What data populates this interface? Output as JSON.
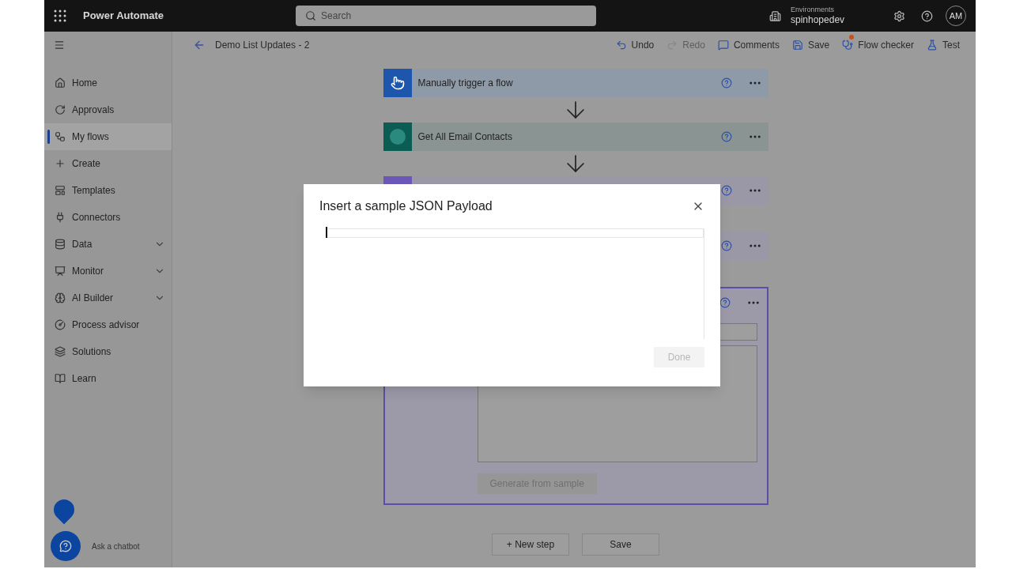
{
  "app": {
    "name": "Power Automate"
  },
  "search": {
    "placeholder": "Search"
  },
  "environment": {
    "label": "Environments",
    "name": "spinhopedev"
  },
  "user": {
    "initials": "AM"
  },
  "flow_title": "Demo List Updates - 2",
  "toolbar": [
    {
      "label": "Undo",
      "disabled": false,
      "alert": false
    },
    {
      "label": "Redo",
      "disabled": true,
      "alert": false
    },
    {
      "label": "Comments",
      "disabled": false,
      "alert": false
    },
    {
      "label": "Save",
      "disabled": false,
      "alert": false
    },
    {
      "label": "Flow checker",
      "disabled": false,
      "alert": true
    },
    {
      "label": "Test",
      "disabled": false,
      "alert": false
    }
  ],
  "sidebar": {
    "items": [
      {
        "label": "Home",
        "selected": false,
        "expandable": false
      },
      {
        "label": "Approvals",
        "selected": false,
        "expandable": false
      },
      {
        "label": "My flows",
        "selected": true,
        "expandable": false
      },
      {
        "label": "Create",
        "selected": false,
        "expandable": false
      },
      {
        "label": "Templates",
        "selected": false,
        "expandable": false
      },
      {
        "label": "Connectors",
        "selected": false,
        "expandable": false
      },
      {
        "label": "Data",
        "selected": false,
        "expandable": true
      },
      {
        "label": "Monitor",
        "selected": false,
        "expandable": true
      },
      {
        "label": "AI Builder",
        "selected": false,
        "expandable": true
      },
      {
        "label": "Process advisor",
        "selected": false,
        "expandable": false
      },
      {
        "label": "Solutions",
        "selected": false,
        "expandable": false
      },
      {
        "label": "Learn",
        "selected": false,
        "expandable": false
      }
    ],
    "chatbot": "Ask a chatbot"
  },
  "steps": [
    {
      "kind": "trigger",
      "title": "Manually trigger a flow",
      "expanded": false
    },
    {
      "kind": "sharepoint",
      "title": "Get All Email Contacts",
      "expanded": false
    },
    {
      "kind": "action",
      "expanded": false
    },
    {
      "kind": "action",
      "expanded": false
    },
    {
      "kind": "action",
      "expanded": true,
      "button": {
        "label": "Generate from sample",
        "disabled": true
      }
    }
  ],
  "bottom_buttons": [
    "+ New step",
    "Save"
  ],
  "dialog": {
    "title": "Insert a sample JSON Payload",
    "button": {
      "label": "Done",
      "disabled": true
    }
  }
}
